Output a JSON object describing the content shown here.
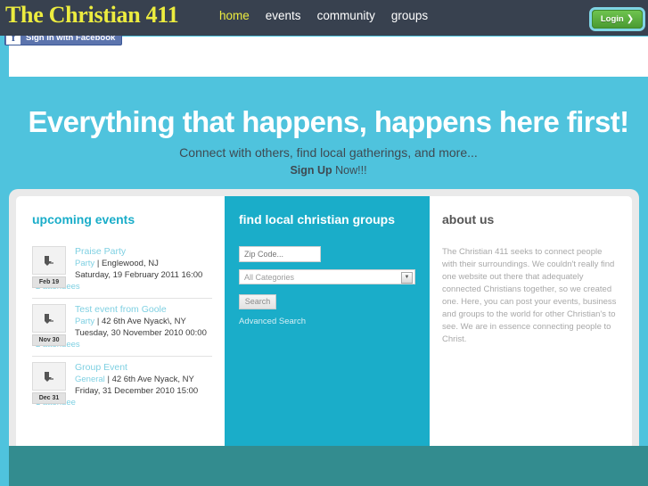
{
  "site": {
    "logo": "The Christian 411"
  },
  "nav": {
    "items": [
      {
        "label": "home",
        "active": true
      },
      {
        "label": "events",
        "active": false
      },
      {
        "label": "community",
        "active": false
      },
      {
        "label": "groups",
        "active": false
      }
    ],
    "login_label": "Login",
    "login_chevron": "❯"
  },
  "facebook": {
    "mark": "f",
    "label": "Sign in with Facebook"
  },
  "hero": {
    "headline": "Everything that happens, happens here first!",
    "subhead": "Connect with others, find local gatherings, and more...",
    "cta_link": "Sign Up",
    "cta_rest": " Now!!!"
  },
  "events_panel": {
    "title": "upcoming events",
    "events": [
      {
        "title": "Praise Party",
        "category": "Party",
        "location": "Englewood, NJ",
        "when": "Saturday, 19 February 2011 16:00",
        "attendees": "2 attendees",
        "date_badge": "Feb 19"
      },
      {
        "title": "Test event from Goole",
        "category": "Party",
        "location": "42 6th Ave Nyack\\, NY",
        "when": "Tuesday, 30 November 2010 00:00",
        "attendees": "2 attendees",
        "date_badge": "Nov 30"
      },
      {
        "title": "Group Event",
        "category": "General",
        "location": "42 6th Ave Nyack, NY",
        "when": "Friday, 31 December 2010 15:00",
        "attendees": "1 attendee",
        "date_badge": "Dec 31"
      }
    ]
  },
  "groups_panel": {
    "title": "find local christian groups",
    "zip_placeholder": "Zip Code...",
    "zip_value": "",
    "category_selected": "All Categories",
    "dropdown_arrow": "▼",
    "search_label": "Search",
    "advanced_label": "Advanced Search"
  },
  "about_panel": {
    "title": "about us",
    "body": "The Christian 411 seeks to connect people with their surroundings. We couldn't really find one website out there that adequately connected Christians together, so we created one. Here, you can post your events, business and groups to the world for other Christian's to see. We are in essence connecting people to Christ."
  },
  "colors": {
    "navbar": "#38414f",
    "accent_yellow": "#ecec3f",
    "hero_cyan": "#4fc3dd",
    "panel_teal": "#1aadc9",
    "footer_teal": "#338c8f",
    "link_blue": "#7fd0e2",
    "login_green": "#6fc44f",
    "facebook_blue": "#5c74ad"
  }
}
